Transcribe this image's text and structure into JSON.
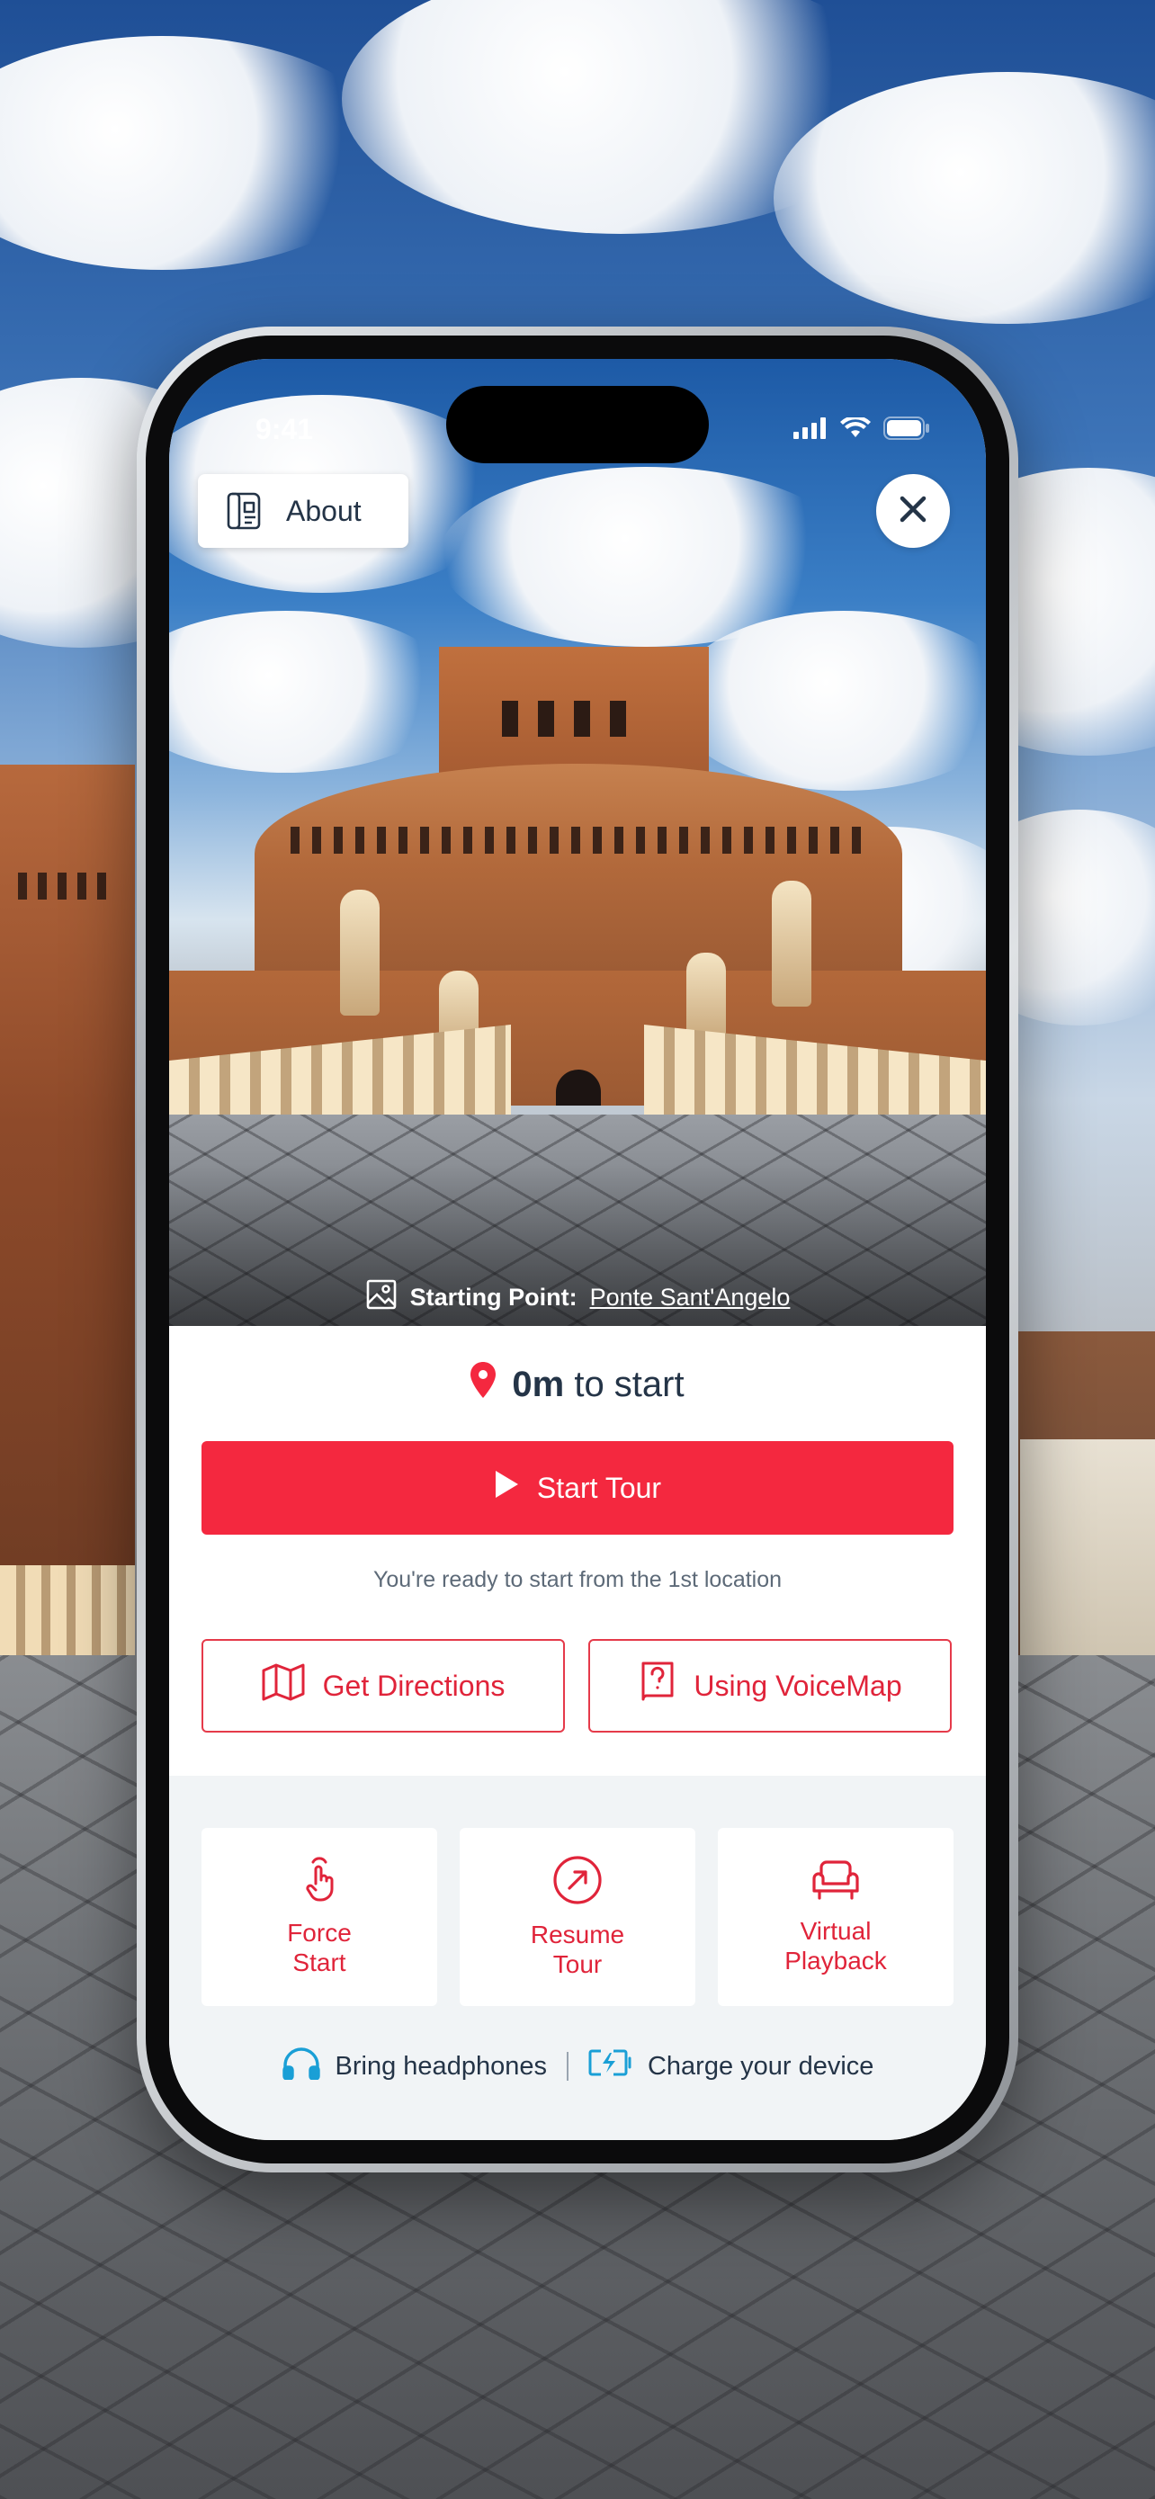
{
  "status_bar": {
    "time": "9:41"
  },
  "header": {
    "about_label": "About"
  },
  "starting_point": {
    "label": "Starting Point:",
    "place": "Ponte Sant'Angelo"
  },
  "distance": {
    "value": "0m",
    "suffix": "to start"
  },
  "actions": {
    "start_tour": "Start Tour",
    "ready_text": "You're ready to start from the 1st location",
    "get_directions": "Get Directions",
    "using_voicemap": "Using VoiceMap"
  },
  "tiles": [
    {
      "label": "Force\nStart",
      "icon": "tap-hand-icon"
    },
    {
      "label": "Resume\nTour",
      "icon": "compass-arrow-icon"
    },
    {
      "label": "Virtual\nPlayback",
      "icon": "armchair-icon"
    }
  ],
  "tips": {
    "headphones": "Bring headphones",
    "charge": "Charge your device"
  },
  "colors": {
    "accent": "#f4283f",
    "text_dark": "#243447",
    "tip_icon": "#1a9fd6"
  }
}
